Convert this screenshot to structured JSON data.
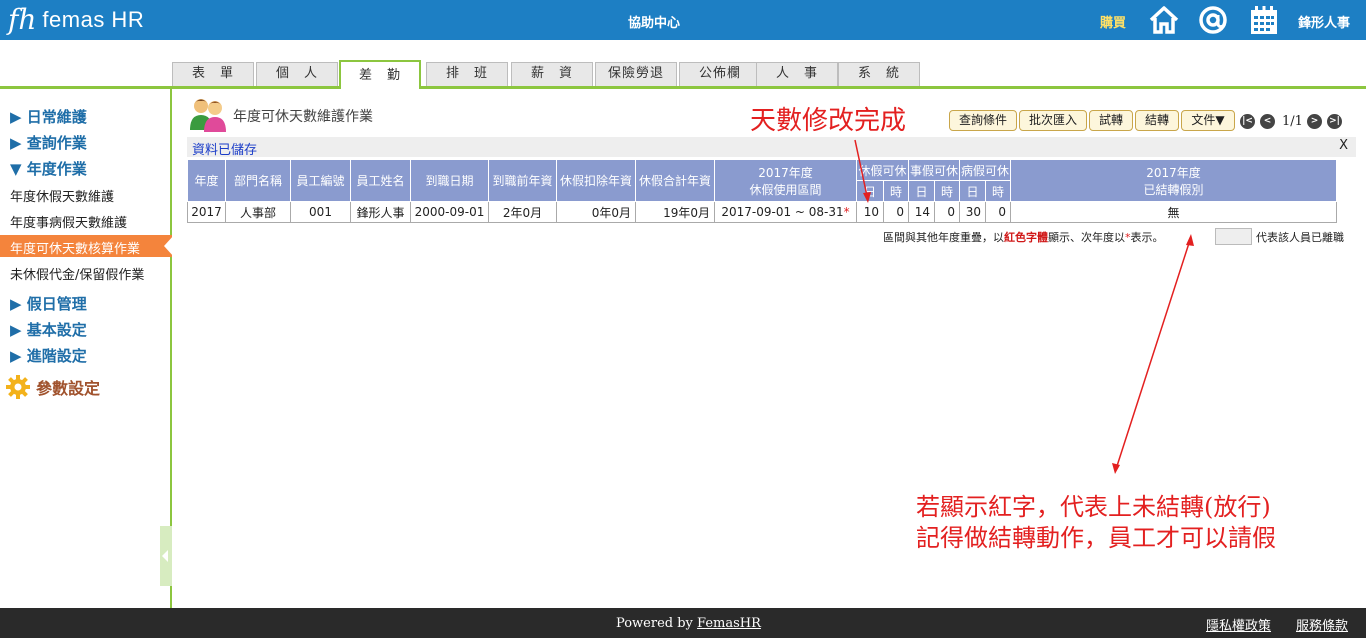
{
  "header": {
    "logo_mark": "fh",
    "logo_text": "femas HR",
    "help_center": "協助中心",
    "buy": "購買",
    "company": "鋒形人事",
    "icons": [
      "home-icon",
      "at-icon",
      "calendar-icon"
    ]
  },
  "tabs": [
    {
      "label": "表　單",
      "active": false
    },
    {
      "label": "個　人",
      "active": false
    },
    {
      "label": "差　勤",
      "active": true
    },
    {
      "label": "排　班",
      "active": false
    },
    {
      "label": "薪　資",
      "active": false
    },
    {
      "label": "保險勞退",
      "active": false
    },
    {
      "label": "公佈欄",
      "active": false
    },
    {
      "label": "人　事",
      "active": false
    },
    {
      "label": "系　統",
      "active": false
    }
  ],
  "sidebar": {
    "groups": [
      "▶ 日常維護",
      "▶ 查詢作業",
      "▼ 年度作業"
    ],
    "items": [
      "年度休假天數維護",
      "年度事病假天數維護",
      "年度可休天數核算作業",
      "未休假代金/保留假作業"
    ],
    "groups2": [
      "▶ 假日管理",
      "▶ 基本設定",
      "▶ 進階設定"
    ],
    "param": "參數設定"
  },
  "page": {
    "title": "年度可休天數維護作業",
    "saved_msg": "資料已儲存",
    "close": "X"
  },
  "toolbar": {
    "query": "查詢條件",
    "batch_import": "批次匯入",
    "trial": "試轉",
    "transfer": "結轉",
    "docs": "文件▼",
    "page": "1/1",
    "nav": [
      "|<",
      "<",
      ">",
      ">|"
    ]
  },
  "table": {
    "headers": {
      "year": "年度",
      "dept": "部門名稱",
      "emp_no": "員工編號",
      "emp_name": "員工姓名",
      "hire": "到職日期",
      "seniority_before": "到職前年資",
      "seniority_deduct": "休假扣除年資",
      "seniority_total": "休假合計年資",
      "period_title": "2017年度",
      "period_sub": "休假使用區間",
      "annual": "休假可休",
      "personal": "事假可休",
      "sick": "病假可休",
      "day": "日",
      "hour": "時",
      "transfer_title": "2017年度",
      "transfer_sub": "已結轉假別"
    },
    "row": {
      "year": "2017",
      "dept": "人事部",
      "emp_no": "001",
      "emp_name": "鋒形人事",
      "hire": "2000-09-01",
      "seniority_before": "2年0月",
      "seniority_deduct": "0年0月",
      "seniority_total": "19年0月",
      "period": "2017-09-01 ~ 08-31",
      "star": "*",
      "annual_day": "10",
      "annual_hour": "0",
      "personal_day": "14",
      "personal_hour": "0",
      "sick_day": "30",
      "sick_hour": "0",
      "transferred": "無"
    }
  },
  "notes": {
    "overlap_a": "區間與其他年度重疊，以",
    "overlap_red": "紅色字體",
    "overlap_b": "顯示、次年度以",
    "overlap_star": "*",
    "overlap_c": "表示。",
    "left": "代表該人員已離職"
  },
  "annotations": {
    "done": "天數修改完成",
    "line1": "若顯示紅字，代表上未結轉(放行)",
    "line2": "記得做結轉動作，員工才可以請假"
  },
  "footer": {
    "powered": "Powered by",
    "brand": "FemasHR",
    "privacy": "隱私權政策",
    "terms": "服務條款"
  },
  "colors": {
    "header_blue": "#1d7fc4",
    "tab_green": "#8cc63f",
    "active_orange": "#f4843c",
    "table_header": "#8a9bcf",
    "annotation_red": "#e32020"
  }
}
